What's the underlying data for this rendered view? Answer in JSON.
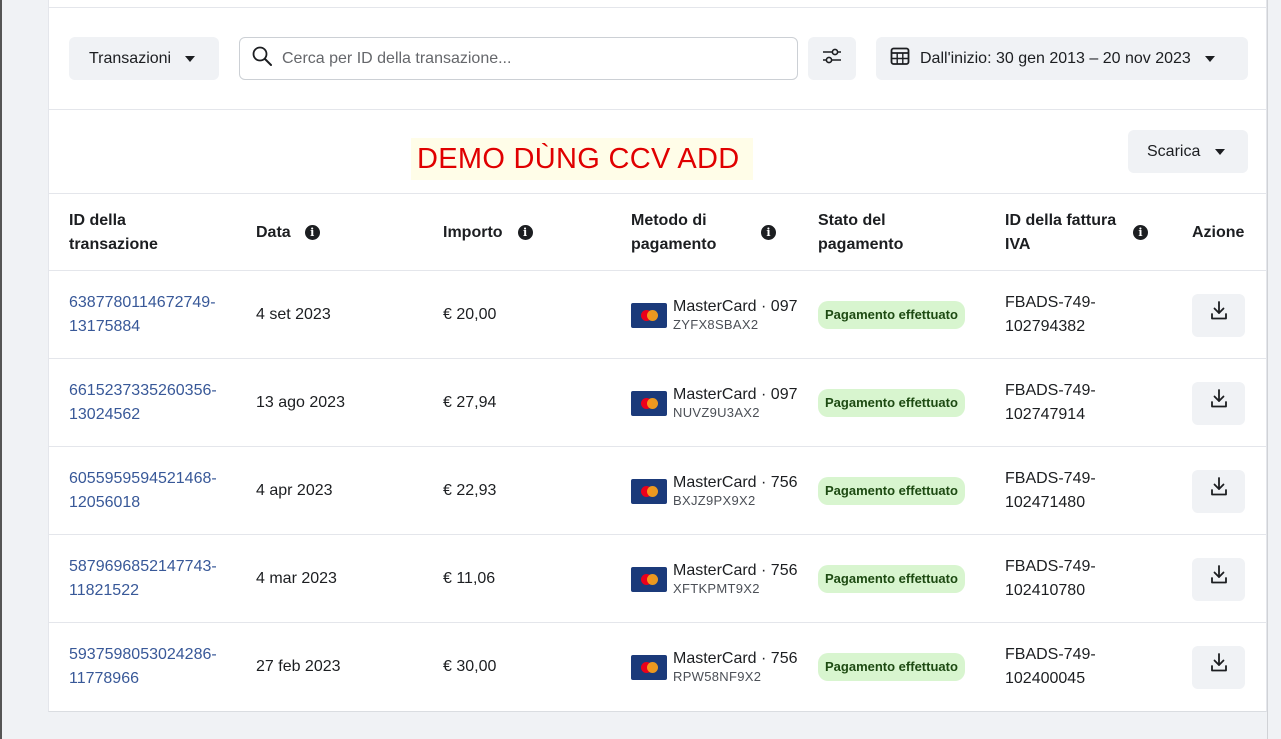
{
  "filters": {
    "transactions_dropdown": "Transazioni",
    "search_placeholder": "Cerca per ID della transazione...",
    "date_range": "Dall'inizio: 30 gen 2013 – 20 nov 2023"
  },
  "banner": {
    "text": "DEMO DÙNG CCV ADD",
    "text_color": "#e00000",
    "background": "#fffde8"
  },
  "download_all": "Scarica",
  "icons": {
    "search": "search-icon",
    "filter": "sliders-icon",
    "calendar": "calendar-icon",
    "info": "info-icon",
    "card": "mastercard-icon",
    "download": "download-icon"
  },
  "colors": {
    "link": "#385898",
    "badge_bg": "#d8f5cf",
    "badge_text": "#1d4a12"
  },
  "table": {
    "headers": {
      "tx_id": [
        "ID della",
        "transazione"
      ],
      "date": "Data",
      "amount": "Importo",
      "method": [
        "Metodo di",
        "pagamento"
      ],
      "status": [
        "Stato del",
        "pagamento"
      ],
      "invoice": [
        "ID della fattura",
        "IVA"
      ],
      "action": "Azione"
    },
    "rows": [
      {
        "tx_id": [
          "6387780114672749-",
          "13175884"
        ],
        "date": "4 set 2023",
        "amount": "€ 20,00",
        "method": "MasterCard · 097",
        "method_code": "ZYFX8SBAX2",
        "status": "Pagamento effettuato",
        "invoice": [
          "FBADS-749-",
          "102794382"
        ]
      },
      {
        "tx_id": [
          "6615237335260356-",
          "13024562"
        ],
        "date": "13 ago 2023",
        "amount": "€ 27,94",
        "method": "MasterCard · 097",
        "method_code": "NUVZ9U3AX2",
        "status": "Pagamento effettuato",
        "invoice": [
          "FBADS-749-",
          "102747914"
        ]
      },
      {
        "tx_id": [
          "6055959594521468-",
          "12056018"
        ],
        "date": "4 apr 2023",
        "amount": "€ 22,93",
        "method": "MasterCard · 756",
        "method_code": "BXJZ9PX9X2",
        "status": "Pagamento effettuato",
        "invoice": [
          "FBADS-749-",
          "102471480"
        ]
      },
      {
        "tx_id": [
          "5879696852147743-",
          "11821522"
        ],
        "date": "4 mar 2023",
        "amount": "€ 11,06",
        "method": "MasterCard · 756",
        "method_code": "XFTKPMT9X2",
        "status": "Pagamento effettuato",
        "invoice": [
          "FBADS-749-",
          "102410780"
        ]
      },
      {
        "tx_id": [
          "5937598053024286-",
          "11778966"
        ],
        "date": "27 feb 2023",
        "amount": "€ 30,00",
        "method": "MasterCard · 756",
        "method_code": "RPW58NF9X2",
        "status": "Pagamento effettuato",
        "invoice": [
          "FBADS-749-",
          "102400045"
        ]
      }
    ]
  }
}
